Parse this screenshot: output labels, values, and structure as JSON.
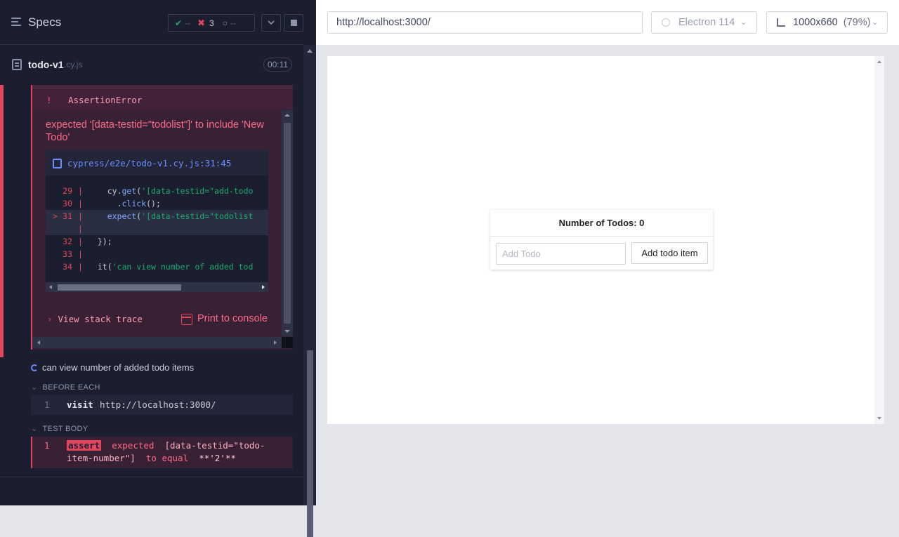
{
  "sidebar": {
    "title": "Specs",
    "stats": {
      "passed": "--",
      "failed": "3",
      "pending": "--"
    },
    "spec_file": {
      "name": "todo-v1",
      "ext": ".cy.js",
      "duration": "00:11"
    }
  },
  "error": {
    "type": "AssertionError",
    "message": "expected '[data-testid=\"todolist\"]' to include 'New Todo'",
    "code_frame": {
      "path": "cypress/e2e/todo-v1.cy.js:31:45",
      "lines": [
        {
          "num": "29",
          "code": "    cy.get('[data-testid=\"add-todo",
          "hl": false
        },
        {
          "num": "30",
          "code": "      .click();",
          "hl": false
        },
        {
          "num": "31",
          "code": "    expect('[data-testid=\"todolist",
          "hl": true
        },
        {
          "num": "",
          "code": "",
          "hl": true
        },
        {
          "num": "32",
          "code": "  });",
          "hl": false
        },
        {
          "num": "33",
          "code": "",
          "hl": false
        },
        {
          "num": "34",
          "code": "  it('can view number of added tod",
          "hl": false
        }
      ]
    },
    "view_stack_trace": "View stack trace",
    "print_to_console": "Print to console"
  },
  "test2": {
    "title": "can view number of added todo items",
    "before_each_label": "BEFORE EACH",
    "before_cmd": {
      "num": "1",
      "name": "visit",
      "value": "http://localhost:3000/"
    },
    "test_body_label": "TEST BODY",
    "assert_cmd": {
      "num": "1",
      "badge": "assert",
      "text_pre": "expected",
      "subject": "[data-testid=\"todo-item-number\"]",
      "mid": "to equal",
      "expected": "**'2'**"
    }
  },
  "aut": {
    "url": "http://localhost:3000/",
    "browser": "Electron 114",
    "viewport": "1000x660",
    "zoom": "(79%)",
    "todo_title": "Number of Todos: 0",
    "input_placeholder": "Add Todo",
    "add_button": "Add todo item"
  }
}
